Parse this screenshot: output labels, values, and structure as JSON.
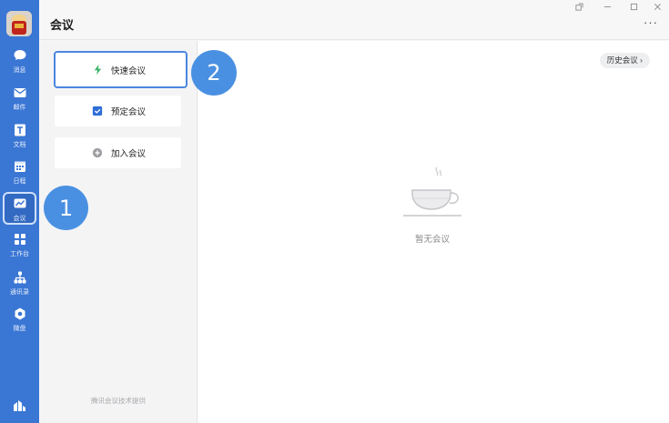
{
  "header": {
    "title": "会议"
  },
  "window_controls": [
    "popout-icon",
    "minimize-icon",
    "maximize-icon",
    "close-icon"
  ],
  "rail": {
    "items": [
      {
        "label": "消息",
        "icon": "chat-bubble-icon"
      },
      {
        "label": "邮件",
        "icon": "mail-icon"
      },
      {
        "label": "文档",
        "icon": "document-icon"
      },
      {
        "label": "日程",
        "icon": "calendar-icon"
      },
      {
        "label": "会议",
        "icon": "meeting-icon",
        "active": true
      },
      {
        "label": "工作台",
        "icon": "workbench-grid-icon"
      },
      {
        "label": "通讯录",
        "icon": "contacts-tree-icon"
      },
      {
        "label": "微盘",
        "icon": "cloud-drive-icon"
      }
    ]
  },
  "actions": {
    "quick": "快速会议",
    "schedule": "预定会议",
    "join": "加入会议"
  },
  "footer_note": "腾讯会议技术提供",
  "main": {
    "history_button": "历史会议 ›",
    "empty_text": "暂无会议"
  },
  "markers": {
    "one": "1",
    "two": "2"
  },
  "colors": {
    "rail": "#3a76d4",
    "accent": "#4b86e0",
    "marker": "#4a90e2",
    "quick_icon": "#3db56b"
  }
}
